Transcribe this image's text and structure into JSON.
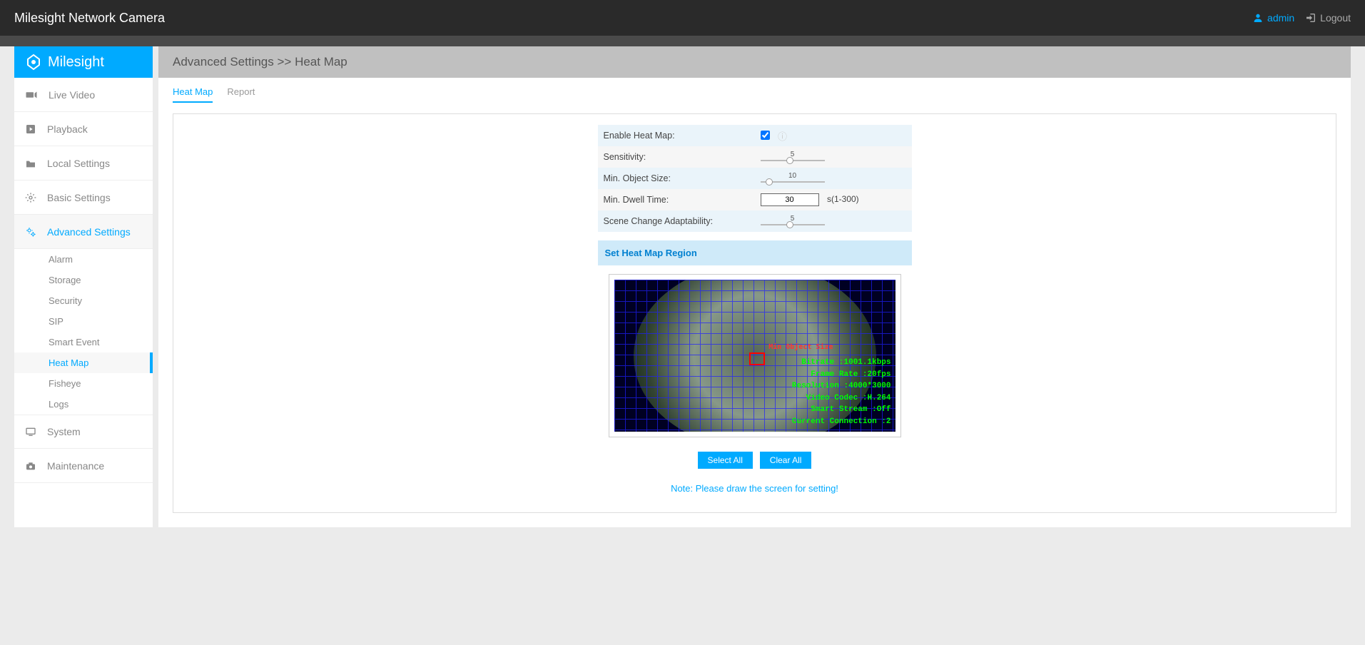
{
  "header": {
    "title": "Milesight Network Camera",
    "user": "admin",
    "logout": "Logout"
  },
  "sidebar": {
    "logo": "Milesight",
    "items": [
      {
        "label": "Live Video"
      },
      {
        "label": "Playback"
      },
      {
        "label": "Local Settings"
      },
      {
        "label": "Basic Settings"
      },
      {
        "label": "Advanced Settings",
        "active": true,
        "subitems": [
          {
            "label": "Alarm"
          },
          {
            "label": "Storage"
          },
          {
            "label": "Security"
          },
          {
            "label": "SIP"
          },
          {
            "label": "Smart Event"
          },
          {
            "label": "Heat Map",
            "active": true
          },
          {
            "label": "Fisheye"
          },
          {
            "label": "Logs"
          }
        ]
      },
      {
        "label": "System"
      },
      {
        "label": "Maintenance"
      }
    ]
  },
  "breadcrumb": "Advanced Settings >> Heat Map",
  "tabs": [
    {
      "label": "Heat Map",
      "active": true
    },
    {
      "label": "Report"
    }
  ],
  "settings": {
    "rows": [
      {
        "label": "Enable Heat Map:",
        "type": "checkbox",
        "checked": true,
        "info": true,
        "bg": "alt"
      },
      {
        "label": "Sensitivity:",
        "type": "slider",
        "value": "5",
        "pos": 40,
        "bg": "norm"
      },
      {
        "label": "Min. Object Size:",
        "type": "slider",
        "value": "10",
        "pos": 8,
        "bg": "alt"
      },
      {
        "label": "Min. Dwell Time:",
        "type": "number",
        "value": "30",
        "unit": "s(1-300)",
        "bg": "norm"
      },
      {
        "label": "Scene Change Adaptability:",
        "type": "slider",
        "value": "5",
        "pos": 40,
        "bg": "alt"
      }
    ]
  },
  "section_header": "Set Heat Map Region",
  "preview": {
    "red_label": "Min Object Size",
    "osd": {
      "bitrate": "Bitrate :1001.1kbps",
      "framerate": "Frame Rate :20fps",
      "resolution": "Resolution :4000*3000",
      "codec": "Video Codec :H.264",
      "smart": "Smart Stream :Off",
      "conn": "Current Connection :2"
    }
  },
  "buttons": {
    "select_all": "Select All",
    "clear_all": "Clear All"
  },
  "note": "Note: Please draw the screen for setting!"
}
